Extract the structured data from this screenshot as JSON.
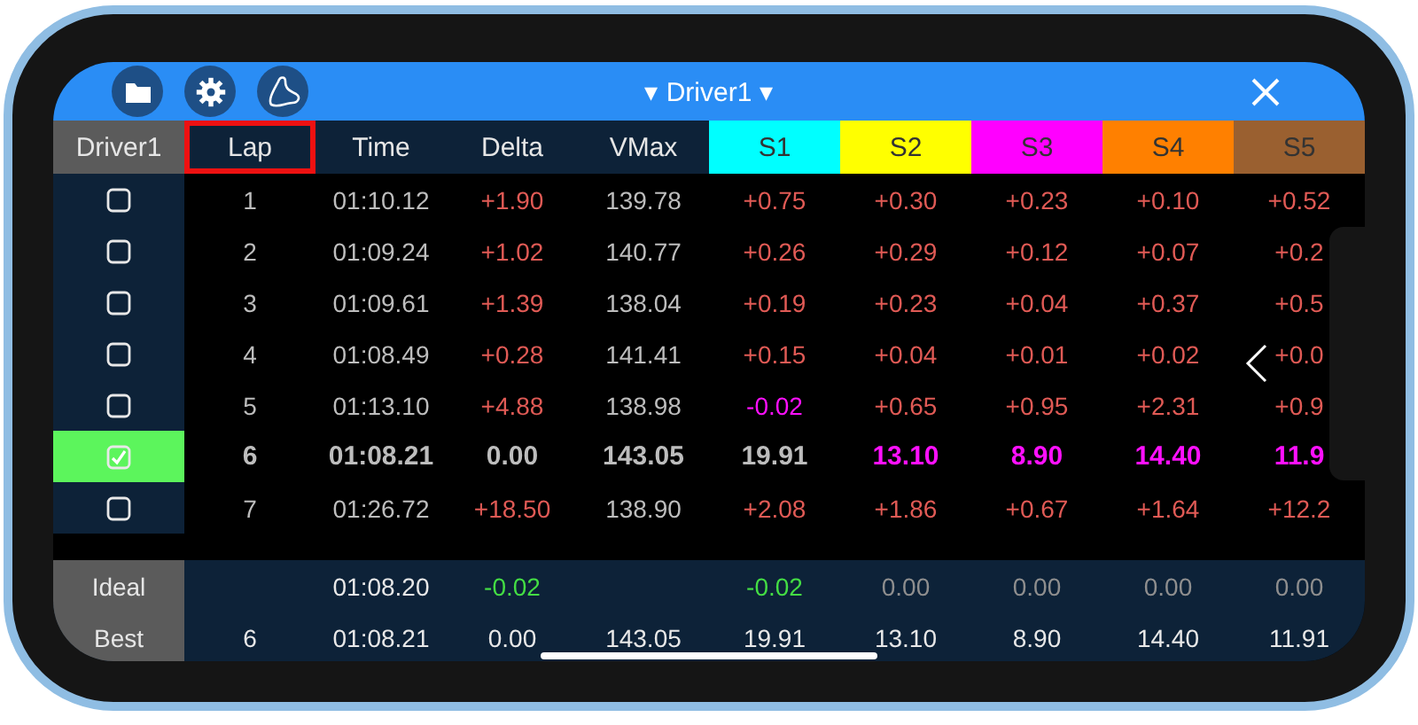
{
  "header": {
    "title": "Driver1",
    "left_arrow": "▾",
    "right_arrow": "▾"
  },
  "columns": [
    {
      "label": "Driver1",
      "kind": "driver"
    },
    {
      "label": "Lap",
      "kind": "plain",
      "selected": true
    },
    {
      "label": "Time",
      "kind": "plain",
      "selected": false
    },
    {
      "label": "Delta",
      "kind": "plain",
      "selected": false
    },
    {
      "label": "VMax",
      "kind": "plain",
      "selected": false
    },
    {
      "label": "S1",
      "kind": "sector",
      "color": "#00ffff",
      "selected": false
    },
    {
      "label": "S2",
      "kind": "sector",
      "color": "#ffff00",
      "selected": false
    },
    {
      "label": "S3",
      "kind": "sector",
      "color": "#ff00ff",
      "selected": false
    },
    {
      "label": "S4",
      "kind": "sector",
      "color": "#ff8000",
      "selected": false
    },
    {
      "label": "S5",
      "kind": "sector",
      "color": "#9a6030",
      "selected": false
    }
  ],
  "rows": [
    {
      "checked": false,
      "cells": [
        {
          "text": "1",
          "kind": "neutral"
        },
        {
          "text": "01:10.12",
          "kind": "neutral"
        },
        {
          "text": "+1.90",
          "kind": "slower"
        },
        {
          "text": "139.78",
          "kind": "neutral"
        },
        {
          "text": "+0.75",
          "kind": "slower"
        },
        {
          "text": "+0.30",
          "kind": "slower"
        },
        {
          "text": "+0.23",
          "kind": "slower"
        },
        {
          "text": "+0.10",
          "kind": "slower"
        },
        {
          "text": "+0.52",
          "kind": "slower"
        }
      ]
    },
    {
      "checked": false,
      "cells": [
        {
          "text": "2",
          "kind": "neutral"
        },
        {
          "text": "01:09.24",
          "kind": "neutral"
        },
        {
          "text": "+1.02",
          "kind": "slower"
        },
        {
          "text": "140.77",
          "kind": "neutral"
        },
        {
          "text": "+0.26",
          "kind": "slower"
        },
        {
          "text": "+0.29",
          "kind": "slower"
        },
        {
          "text": "+0.12",
          "kind": "slower"
        },
        {
          "text": "+0.07",
          "kind": "slower"
        },
        {
          "text": "+0.2",
          "kind": "slower"
        }
      ]
    },
    {
      "checked": false,
      "cells": [
        {
          "text": "3",
          "kind": "neutral"
        },
        {
          "text": "01:09.61",
          "kind": "neutral"
        },
        {
          "text": "+1.39",
          "kind": "slower"
        },
        {
          "text": "138.04",
          "kind": "neutral"
        },
        {
          "text": "+0.19",
          "kind": "slower"
        },
        {
          "text": "+0.23",
          "kind": "slower"
        },
        {
          "text": "+0.04",
          "kind": "slower"
        },
        {
          "text": "+0.37",
          "kind": "slower"
        },
        {
          "text": "+0.5",
          "kind": "slower"
        }
      ]
    },
    {
      "checked": false,
      "cells": [
        {
          "text": "4",
          "kind": "neutral"
        },
        {
          "text": "01:08.49",
          "kind": "neutral"
        },
        {
          "text": "+0.28",
          "kind": "slower"
        },
        {
          "text": "141.41",
          "kind": "neutral"
        },
        {
          "text": "+0.15",
          "kind": "slower"
        },
        {
          "text": "+0.04",
          "kind": "slower"
        },
        {
          "text": "+0.01",
          "kind": "slower"
        },
        {
          "text": "+0.02",
          "kind": "slower"
        },
        {
          "text": "+0.0",
          "kind": "slower"
        }
      ]
    },
    {
      "checked": false,
      "cells": [
        {
          "text": "5",
          "kind": "neutral"
        },
        {
          "text": "01:13.10",
          "kind": "neutral"
        },
        {
          "text": "+4.88",
          "kind": "slower"
        },
        {
          "text": "138.98",
          "kind": "neutral"
        },
        {
          "text": "-0.02",
          "kind": "fastest"
        },
        {
          "text": "+0.65",
          "kind": "slower"
        },
        {
          "text": "+0.95",
          "kind": "slower"
        },
        {
          "text": "+2.31",
          "kind": "slower"
        },
        {
          "text": "+0.9",
          "kind": "slower"
        }
      ]
    },
    {
      "checked": true,
      "cells": [
        {
          "text": "6",
          "kind": "neutral"
        },
        {
          "text": "01:08.21",
          "kind": "neutral"
        },
        {
          "text": "0.00",
          "kind": "neutral"
        },
        {
          "text": "143.05",
          "kind": "neutral"
        },
        {
          "text": "19.91",
          "kind": "neutral"
        },
        {
          "text": "13.10",
          "kind": "fastest"
        },
        {
          "text": "8.90",
          "kind": "fastest"
        },
        {
          "text": "14.40",
          "kind": "fastest"
        },
        {
          "text": "11.9",
          "kind": "fastest"
        }
      ]
    },
    {
      "checked": false,
      "cells": [
        {
          "text": "7",
          "kind": "neutral"
        },
        {
          "text": "01:26.72",
          "kind": "neutral"
        },
        {
          "text": "+18.50",
          "kind": "slower"
        },
        {
          "text": "138.90",
          "kind": "neutral"
        },
        {
          "text": "+2.08",
          "kind": "slower"
        },
        {
          "text": "+1.86",
          "kind": "slower"
        },
        {
          "text": "+0.67",
          "kind": "slower"
        },
        {
          "text": "+1.64",
          "kind": "slower"
        },
        {
          "text": "+12.2",
          "kind": "slower"
        }
      ]
    }
  ],
  "summary": [
    {
      "label": "Ideal",
      "cells": [
        {
          "text": "",
          "kind": "blank"
        },
        {
          "text": "01:08.20",
          "kind": "total"
        },
        {
          "text": "-0.02",
          "kind": "gain"
        },
        {
          "text": "",
          "kind": "blank"
        },
        {
          "text": "-0.02",
          "kind": "gain"
        },
        {
          "text": "0.00",
          "kind": "neutral"
        },
        {
          "text": "0.00",
          "kind": "neutral"
        },
        {
          "text": "0.00",
          "kind": "neutral"
        },
        {
          "text": "0.00",
          "kind": "neutral"
        }
      ]
    },
    {
      "label": "Best",
      "cells": [
        {
          "text": "6",
          "kind": "total"
        },
        {
          "text": "01:08.21",
          "kind": "total"
        },
        {
          "text": "0.00",
          "kind": "total"
        },
        {
          "text": "143.05",
          "kind": "total"
        },
        {
          "text": "19.91",
          "kind": "total"
        },
        {
          "text": "13.10",
          "kind": "total"
        },
        {
          "text": "8.90",
          "kind": "total"
        },
        {
          "text": "14.40",
          "kind": "total"
        },
        {
          "text": "11.91",
          "kind": "total"
        }
      ]
    }
  ]
}
